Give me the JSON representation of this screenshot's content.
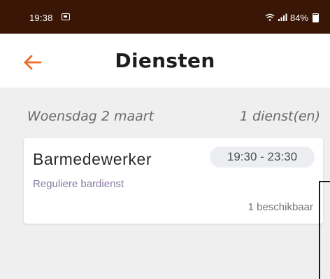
{
  "status_bar": {
    "time": "19:38",
    "battery": "84%",
    "icons": [
      "photo-icon",
      "wifi-icon",
      "signal-icon",
      "battery-icon"
    ]
  },
  "header": {
    "title": "Diensten",
    "back_icon": "arrow-left-icon",
    "accent_color": "#f06a24"
  },
  "list": {
    "date": "Woensdag 2 maart",
    "count": "1 dienst(en)",
    "items": [
      {
        "title": "Barmedewerker",
        "time_range": "19:30 - 23:30",
        "subtitle": "Reguliere bardienst",
        "availability": "1 beschikbaar"
      }
    ]
  }
}
